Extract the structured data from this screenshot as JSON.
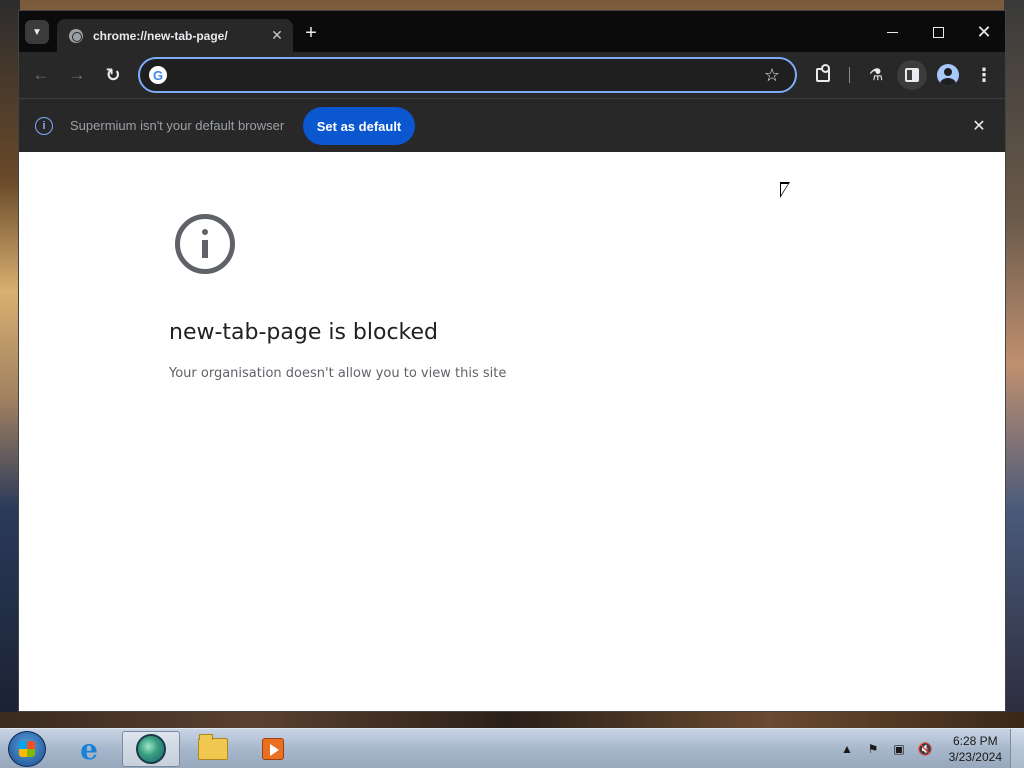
{
  "browser": {
    "tab": {
      "title": "chrome://new-tab-page/",
      "close_glyph": "✕",
      "favicon": "globe-icon"
    },
    "new_tab_glyph": "+",
    "window_controls": {
      "close_glyph": "✕"
    },
    "toolbar": {
      "back_glyph": "←",
      "forward_glyph": "→",
      "reload_glyph": "↻",
      "omnibox_value": "",
      "star_glyph": "☆",
      "labs_glyph": "⚗",
      "menu_glyph": "⋮"
    },
    "infobar": {
      "info_glyph": "i",
      "message": "Supermium isn't your default browser",
      "button_label": "Set as default",
      "close_glyph": "✕"
    },
    "page": {
      "heading": "new-tab-page is blocked",
      "subtext": "Your organisation doesn't allow you to view this site"
    }
  },
  "taskbar": {
    "tray_flag_glyph": "⚑",
    "tray_arrow_glyph": "▲",
    "tray_network_glyph": "▣",
    "tray_volume_glyph": "🔇",
    "clock_time": "6:28 PM",
    "clock_date": "3/23/2024",
    "pinned": [
      "internet-explorer",
      "browser",
      "file-explorer",
      "media-player"
    ]
  },
  "colors": {
    "accent": "#0b57d0",
    "omnibox_focus": "#7cacf8",
    "toolbar_bg": "#282828",
    "titlebar_bg": "#0b0b0b"
  }
}
